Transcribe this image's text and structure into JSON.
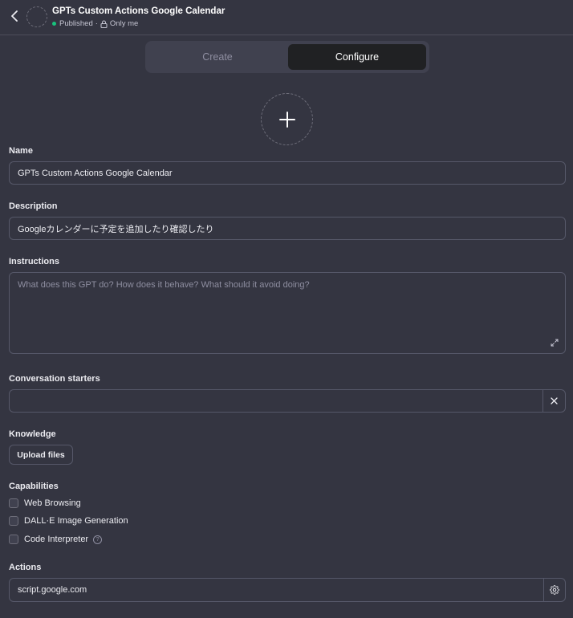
{
  "header": {
    "title": "GPTs Custom Actions Google Calendar",
    "status": "Published",
    "separator": "·",
    "visibility": "Only me"
  },
  "tabs": [
    {
      "label": "Create"
    },
    {
      "label": "Configure"
    }
  ],
  "active_tab": "Configure",
  "form": {
    "name_label": "Name",
    "name_value": "GPTs Custom Actions Google Calendar",
    "description_label": "Description",
    "description_value": "Googleカレンダーに予定を追加したり確認したり",
    "instructions_label": "Instructions",
    "instructions_placeholder": "What does this GPT do? How does it behave? What should it avoid doing?",
    "starters_label": "Conversation starters",
    "starters_value": "",
    "knowledge_label": "Knowledge",
    "upload_label": "Upload files",
    "capabilities_label": "Capabilities",
    "capabilities": [
      {
        "label": "Web Browsing",
        "checked": false
      },
      {
        "label": "DALL·E Image Generation",
        "checked": false
      },
      {
        "label": "Code Interpreter",
        "checked": false
      }
    ],
    "help_glyph": "?",
    "actions_label": "Actions",
    "actions": [
      "script.google.com"
    ]
  },
  "colors": {
    "background": "#343541",
    "active_tab": "#202123",
    "published_dot": "#19c37d",
    "border": "#565869"
  },
  "icons": {
    "back": "chevron-left-icon",
    "add": "plus-icon",
    "lock": "lock-icon",
    "expand": "expand-icon",
    "clear": "close-icon",
    "settings": "gear-icon"
  }
}
